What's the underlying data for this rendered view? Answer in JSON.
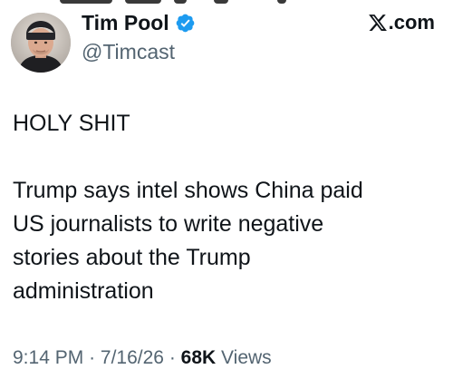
{
  "tweet": {
    "author": {
      "display_name": "Tim Pool",
      "handle": "@Timcast",
      "verified": true,
      "avatar_icon": "user-avatar-photo"
    },
    "source": {
      "label": ".com",
      "logo_icon": "x-logo-icon"
    },
    "text": "HOLY SHIT\n\nTrump says intel shows China paid\nUS journalists to write negative\nstories about the Trump\nadministration",
    "meta": {
      "time": "9:14 PM",
      "separator": "·",
      "date": "7/16/26",
      "views_count": "68K",
      "views_label": "Views"
    },
    "colors": {
      "text_primary": "#0f1419",
      "text_secondary": "#536471",
      "verified_blue": "#1d9bf0"
    }
  }
}
